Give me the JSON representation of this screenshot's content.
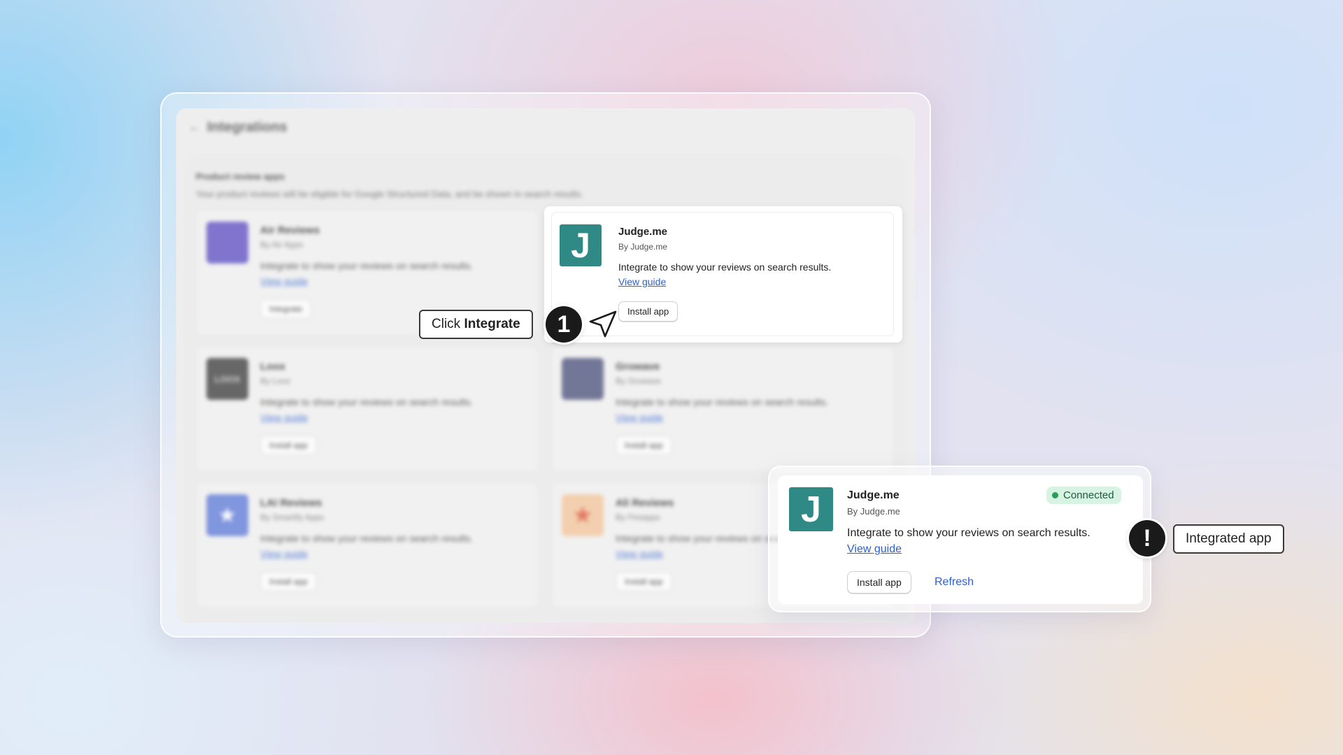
{
  "page": {
    "title": "Integrations",
    "section_title": "Product review apps",
    "section_desc": "Your product reviews will be eligible for Google Structured Data, and be shown in search results."
  },
  "apps": [
    {
      "name": "Air Reviews",
      "by": "By Air Apps",
      "desc": "Integrate to show your reviews on search results.",
      "guide": "View guide",
      "button": "Integrate",
      "logo_color": "#5b4bc4",
      "logo_text": ""
    },
    {
      "name": "Judge.me",
      "by": "By Judge.me",
      "desc": "Integrate to show your reviews on search results.",
      "guide": "View guide",
      "button": "Install app",
      "logo_color": "#2f8a86",
      "logo_text": "J"
    },
    {
      "name": "Loox",
      "by": "By Loox",
      "desc": "Integrate to show your reviews on search results.",
      "guide": "View guide",
      "button": "Install app",
      "logo_color": "#3a3a3a",
      "logo_text": "LOOX"
    },
    {
      "name": "Growave",
      "by": "By Growave",
      "desc": "Integrate to show your reviews on search results.",
      "guide": "View guide",
      "button": "Install app",
      "logo_color": "#4a4f7a",
      "logo_text": ""
    },
    {
      "name": "LAI Reviews",
      "by": "By Smartify Apps",
      "desc": "Integrate to show your reviews on search results.",
      "guide": "View guide",
      "button": "Install app",
      "logo_color": "#5b78d8",
      "logo_text": "★"
    },
    {
      "name": "Ali Reviews",
      "by": "By Fireapps",
      "desc": "Integrate to show your reviews on search results.",
      "guide": "View guide",
      "button": "Install app",
      "logo_color": "#f4c59a",
      "logo_text": "★"
    }
  ],
  "step1": {
    "number": "1",
    "callout_prefix": "Click ",
    "callout_bold": "Integrate"
  },
  "result": {
    "name": "Judge.me",
    "by": "By Judge.me",
    "desc": "Integrate to show your reviews on search results.",
    "guide": "View guide",
    "install_button": "Install app",
    "refresh": "Refresh",
    "status": "Connected",
    "status_color": "#2a9d5c",
    "logo_text": "J"
  },
  "step2": {
    "icon": "!",
    "callout": "Integrated app"
  },
  "icons": {
    "back": "arrow-left-icon",
    "cursor": "pointer-arrow-icon",
    "status_dot": "status-dot-icon"
  }
}
